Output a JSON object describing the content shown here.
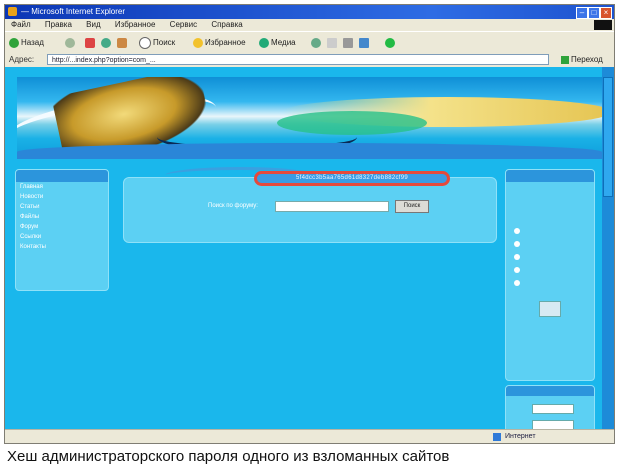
{
  "window": {
    "title": "— Microsoft Internet Explorer"
  },
  "menubar": {
    "items": [
      "Файл",
      "Правка",
      "Вид",
      "Избранное",
      "Сервис",
      "Справка"
    ]
  },
  "toolbar": {
    "back": "Назад",
    "search": "Поиск",
    "favorites": "Избранное",
    "media": "Медиа"
  },
  "addressbar": {
    "label": "Адрес:",
    "url": "http://...index.php?option=com_...",
    "go": "Переход"
  },
  "page": {
    "left_menu": [
      "Главная",
      "Новости",
      "Статьи",
      "Файлы",
      "Форум",
      "Ссылки",
      "Контакты"
    ],
    "hash": "5f4dcc3b5aa765d61d8327deb882cf99",
    "search_label": "Поиск по форуму:",
    "search_button": "Поиск",
    "note": "",
    "poll_options": [
      "",
      "",
      "",
      "",
      ""
    ],
    "poll_links": [],
    "login_title": ""
  },
  "statusbar": {
    "zone": "Интернет"
  },
  "caption": "Хеш администраторского пароля одного из взломанных сайтов",
  "colors": {
    "page_bg": "#1ab7ec",
    "highlight": "#e54a3c",
    "titlebar": "#0b36b5"
  }
}
